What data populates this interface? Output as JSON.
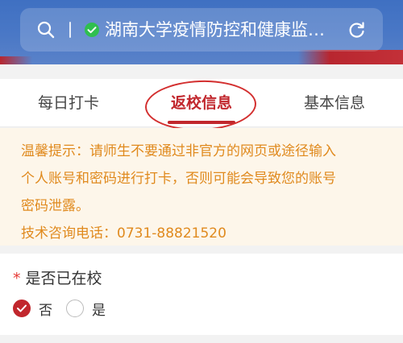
{
  "browser": {
    "url_title": "湖南大学疫情防控和健康监…"
  },
  "tabs": [
    {
      "label": "每日打卡",
      "active": false
    },
    {
      "label": "返校信息",
      "active": true
    },
    {
      "label": "基本信息",
      "active": false
    }
  ],
  "notice": {
    "line1": "温馨提示：请师生不要通过非官方的网页或途径输入",
    "line2": "个人账号和密码进行打卡，否则可能会导致您的账号",
    "line3": "密码泄露。",
    "line4": "技术咨询电话：0731-88821520"
  },
  "form": {
    "question": {
      "required_mark": "*",
      "label": "是否已在校",
      "options": [
        {
          "label": "否",
          "selected": true
        },
        {
          "label": "是",
          "selected": false
        }
      ]
    }
  },
  "colors": {
    "accent": "#c1272d",
    "notice_text": "#e08a1e",
    "notice_bg": "#fdf6ea",
    "header_blue": "#4a78c6"
  }
}
